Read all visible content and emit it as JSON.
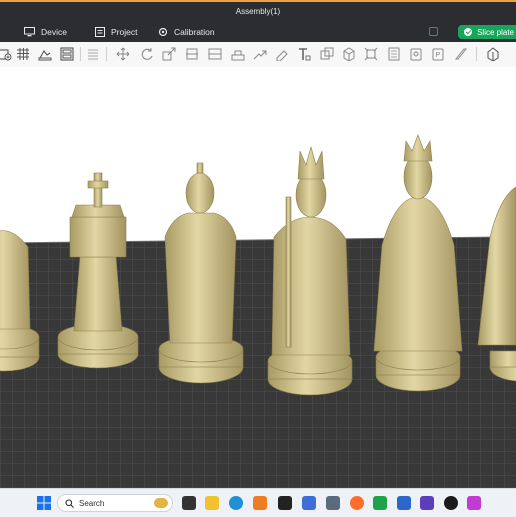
{
  "window": {
    "title": "Assembly(1)"
  },
  "tabs": [
    {
      "label": "Device",
      "icon": "monitor-icon"
    },
    {
      "label": "Project",
      "icon": "project-icon"
    },
    {
      "label": "Calibration",
      "icon": "calibration-icon"
    }
  ],
  "actions": {
    "slice_label": "Slice plate"
  },
  "colors": {
    "accent": "#18a75a",
    "topbar": "#2b2d30",
    "plate": "#3a3a3a",
    "grid_line": "#555555",
    "model": "#d9cc95"
  },
  "toolbar_icons": [
    "add-object-icon",
    "add-plate-icon",
    "auto-orient-icon",
    "arrange-icon",
    "split-icon",
    "move-icon",
    "rotate-icon",
    "scale-icon",
    "cut-icon",
    "place-on-face-icon",
    "paint-support-icon",
    "seam-paint-icon",
    "text-icon",
    "mesh-boolean-icon",
    "measure-icon",
    "assembly-icon",
    "variable-layer-icon",
    "lock-icon",
    "brim-ear-icon",
    "color-paint-icon",
    "view-orientation-icon"
  ],
  "taskbar": {
    "search_placeholder": "Search",
    "apps": [
      "windows-start-icon",
      "task-view-icon",
      "file-explorer-icon",
      "edge-icon",
      "app-icon-orange",
      "bambu-studio-icon",
      "store-icon",
      "calculator-icon",
      "firefox-icon",
      "app-icon-green",
      "app-icon-blue",
      "app-icon-purple",
      "media-player-icon",
      "app-icon-pink"
    ]
  }
}
